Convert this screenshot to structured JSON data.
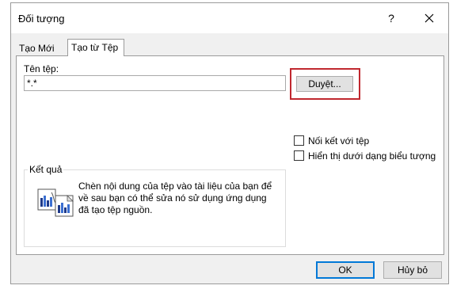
{
  "window": {
    "title": "Đối tượng",
    "help_label": "?"
  },
  "tabs": [
    {
      "label": "Tạo Mới",
      "active": false
    },
    {
      "label": "Tạo từ Tệp",
      "active": true
    }
  ],
  "file": {
    "label": "Tên tệp:",
    "value": "*.*",
    "browse_label": "Duyệt..."
  },
  "options": {
    "link_label": "Nối kết với tệp",
    "link_checked": false,
    "icon_label": "Hiển thị dưới dạng biểu tượng",
    "icon_checked": false
  },
  "result": {
    "legend": "Kết quả",
    "description": "Chèn nội dung của tệp vào tài liệu của bạn để về sau bạn có thể sửa nó sử dụng ứng dụng đã tạo tệp nguồn."
  },
  "buttons": {
    "ok_label": "OK",
    "cancel_label": "Hủy bỏ"
  },
  "colors": {
    "highlight": "#c0282f",
    "focus": "#0078d7"
  }
}
